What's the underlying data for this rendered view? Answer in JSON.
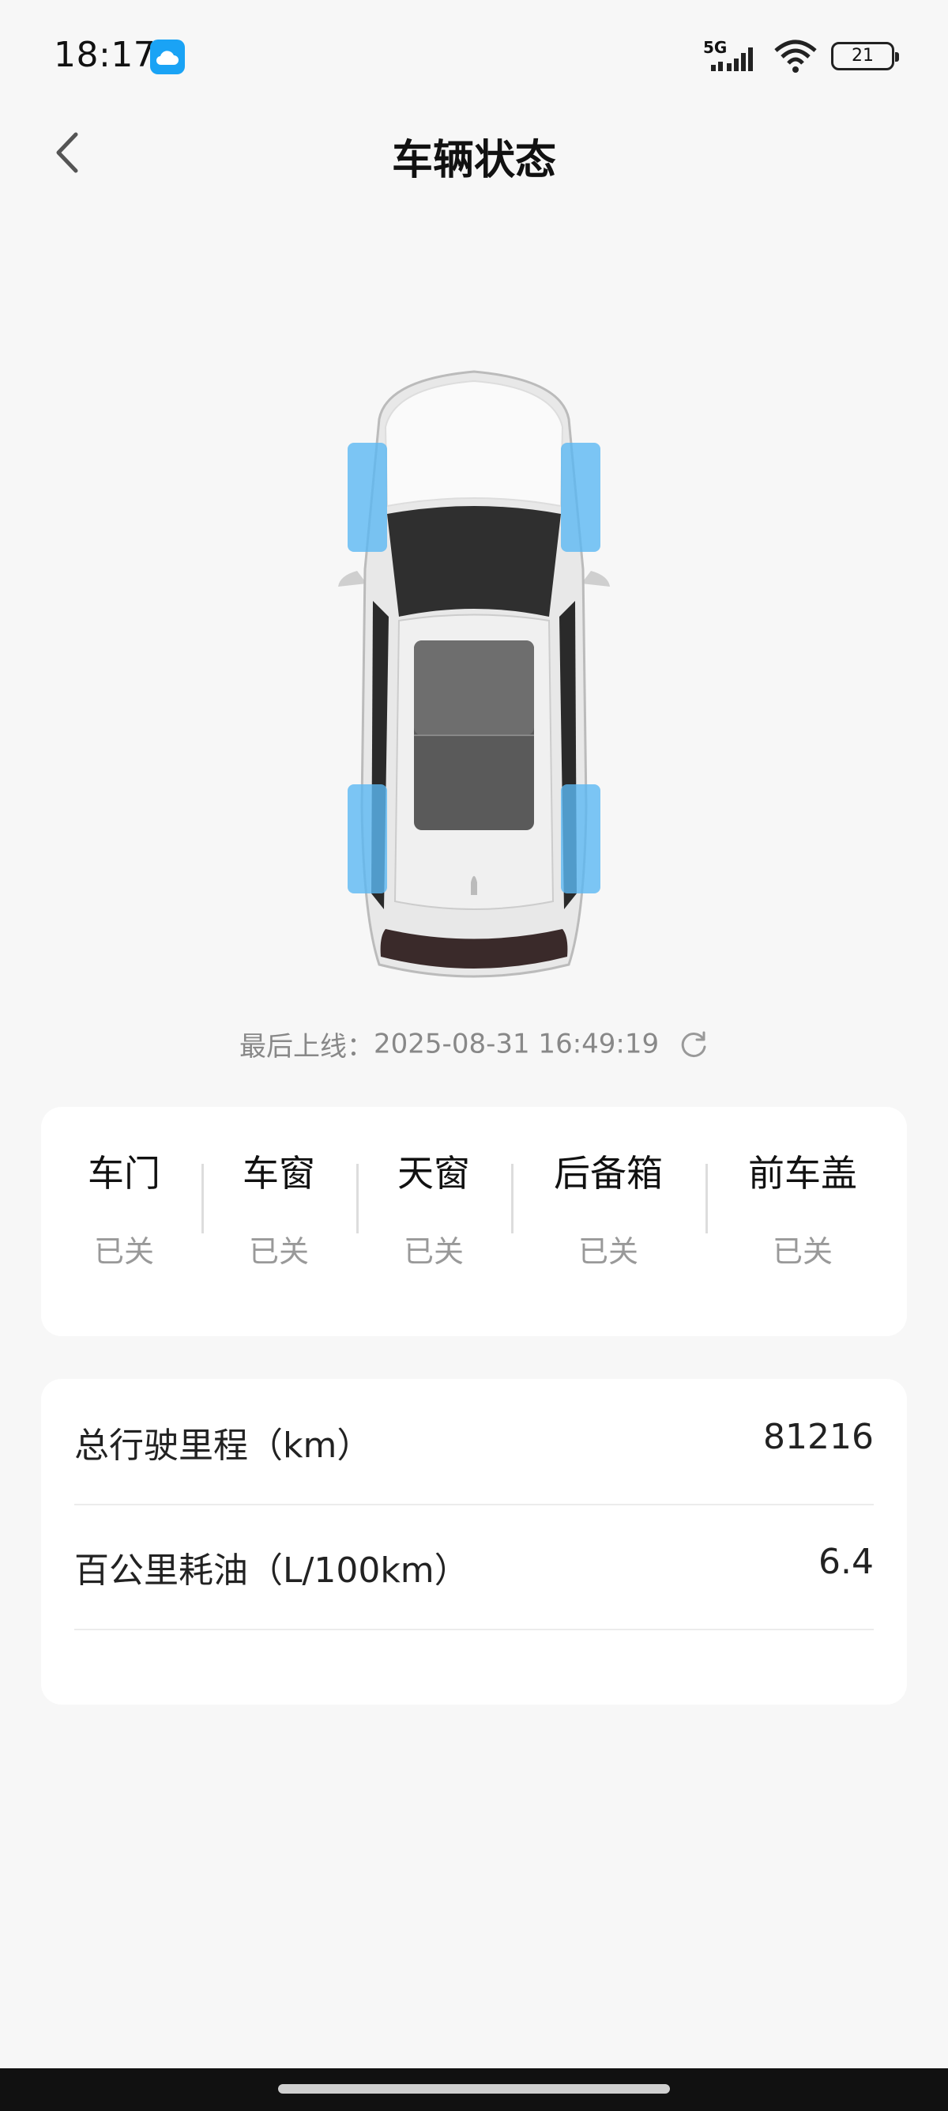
{
  "status_bar": {
    "time": "18:17",
    "network": "5G",
    "battery": "21"
  },
  "header": {
    "title": "车辆状态"
  },
  "last_online": {
    "label": "最后上线：",
    "timestamp": "2025-08-31 16:49:19"
  },
  "status_items": [
    {
      "label": "车门",
      "value": "已关"
    },
    {
      "label": "车窗",
      "value": "已关"
    },
    {
      "label": "天窗",
      "value": "已关"
    },
    {
      "label": "后备箱",
      "value": "已关"
    },
    {
      "label": "前车盖",
      "value": "已关"
    }
  ],
  "metrics": [
    {
      "label": "总行驶里程（km）",
      "value": "81216"
    },
    {
      "label": "百公里耗油（L/100km）",
      "value": "6.4"
    }
  ],
  "colors": {
    "tire_highlight": "#5bb8f2",
    "accent": "#1aa3f5"
  }
}
